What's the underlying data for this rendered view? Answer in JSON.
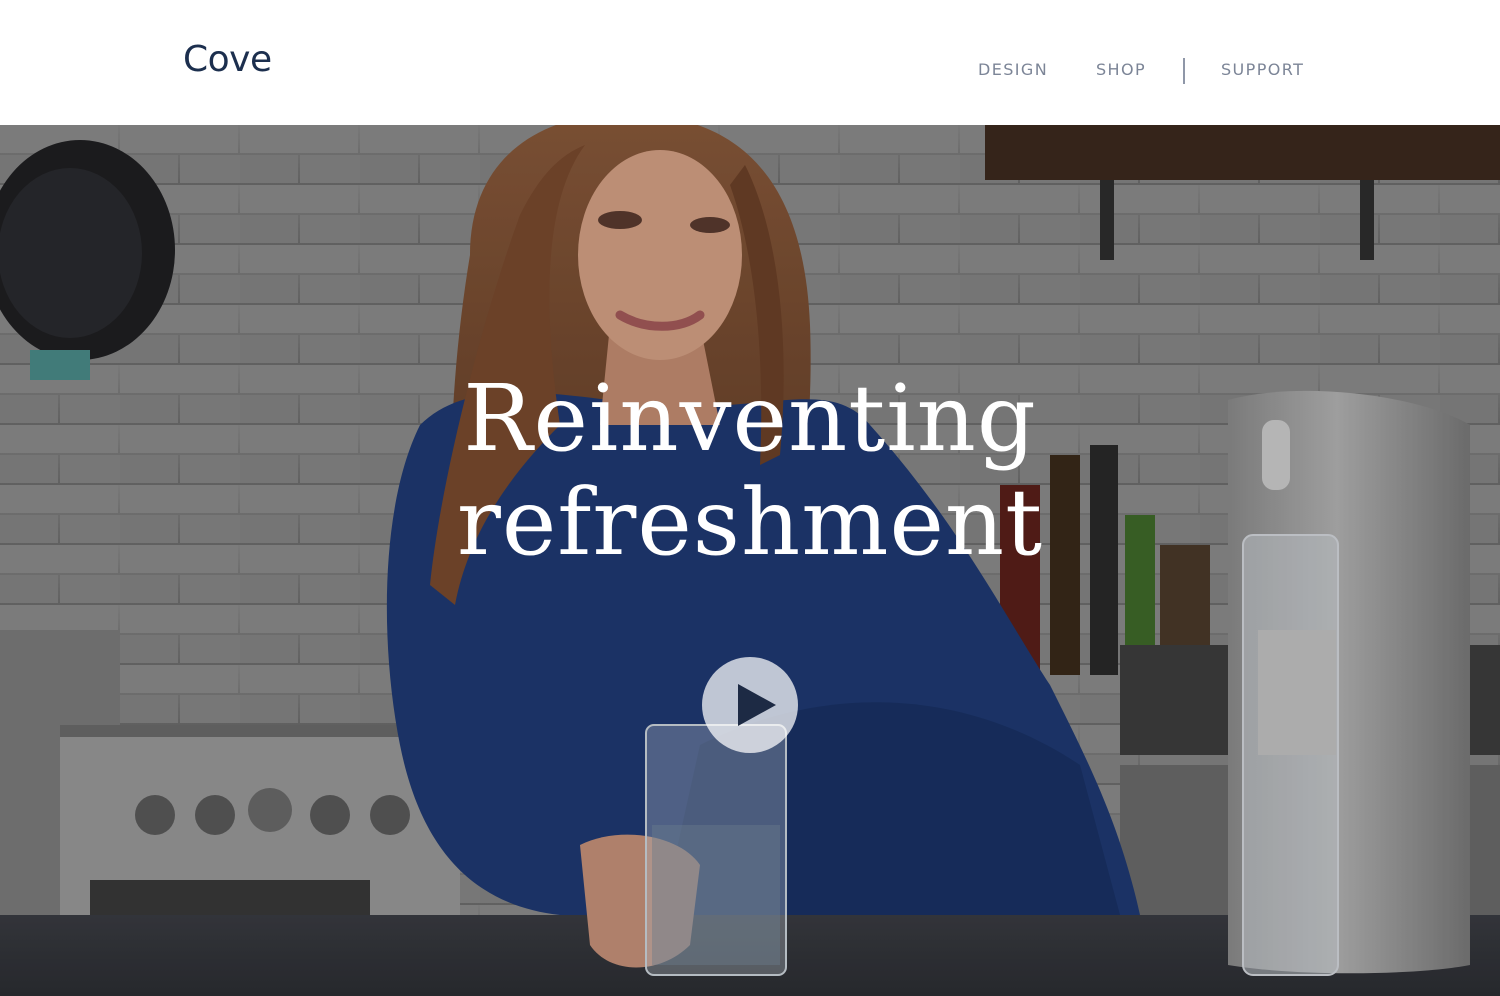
{
  "brand": {
    "logo_text": "Cove",
    "color": "#1c2f4e"
  },
  "nav": {
    "items": [
      {
        "label": "DESIGN"
      },
      {
        "label": "SHOP"
      },
      {
        "label": "SUPPORT"
      }
    ],
    "color": "#7c8597"
  },
  "hero": {
    "title_line1": "Reinventing",
    "title_line2": "refreshment",
    "play_icon": "play-icon",
    "shirt_color": "#1f3a73"
  }
}
